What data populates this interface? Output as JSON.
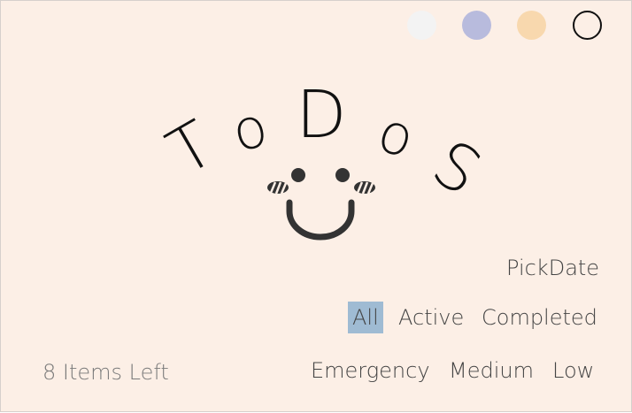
{
  "logo": {
    "letters": [
      "T",
      "o",
      "D",
      "o",
      "S"
    ]
  },
  "theme_swatches": [
    {
      "name": "white",
      "color": "#f3f3f3"
    },
    {
      "name": "lavender",
      "color": "#b8bbdd"
    },
    {
      "name": "peach",
      "color": "#f8d8ae"
    },
    {
      "name": "outline",
      "color": "#fcefe6"
    }
  ],
  "pick_date_label": "PickDate",
  "filters": {
    "all": "All",
    "active": "Active",
    "completed": "Completed",
    "selected": "all"
  },
  "priorities": {
    "emergency": "Emergency",
    "medium": "Medium",
    "low": "Low"
  },
  "items_left_label": "8 Items Left",
  "colors": {
    "background": "#fcefe6",
    "selected_filter": "#9fbbd3",
    "text": "#444444",
    "muted_text": "#7a7a7a",
    "face": "#333333"
  }
}
